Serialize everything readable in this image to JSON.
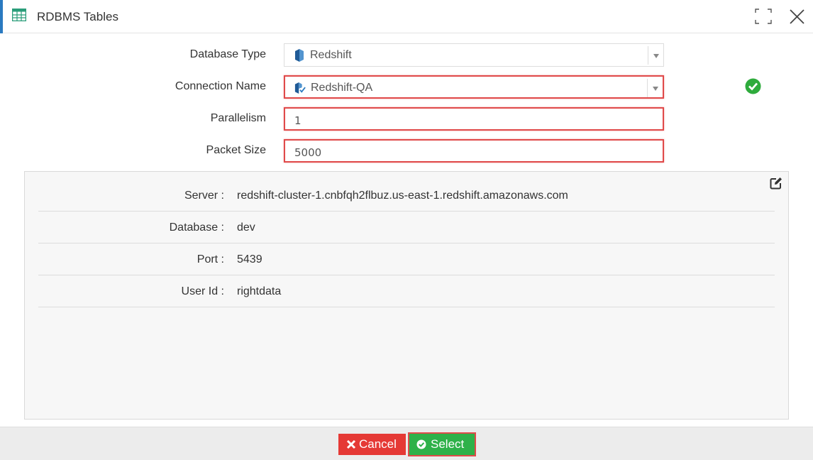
{
  "window": {
    "title": "RDBMS Tables",
    "icons": {
      "app": "table-grid-icon",
      "maximize": "maximize-icon",
      "close": "close-icon"
    }
  },
  "form": {
    "database_type": {
      "label": "Database Type",
      "value": "Redshift",
      "icon": "redshift-icon"
    },
    "connection_name": {
      "label": "Connection Name",
      "value": "Redshift-QA",
      "icon": "redshift-connection-icon",
      "status_icon": "check-circle-icon"
    },
    "parallelism": {
      "label": "Parallelism",
      "value": "1"
    },
    "packet_size": {
      "label": "Packet Size",
      "value": "5000"
    }
  },
  "details": {
    "edit_icon": "edit-icon",
    "rows": [
      {
        "key": "Server :",
        "value": "redshift-cluster-1.cnbfqh2flbuz.us-east-1.redshift.amazonaws.com"
      },
      {
        "key": "Database :",
        "value": "dev"
      },
      {
        "key": "Port :",
        "value": "5439"
      },
      {
        "key": "User Id :",
        "value": "rightdata"
      }
    ]
  },
  "footer": {
    "cancel_label": "Cancel",
    "select_label": "Select"
  },
  "colors": {
    "accent": "#2a7ac0",
    "error_border": "#e04a4a",
    "success": "#2eb149",
    "danger": "#e53935"
  }
}
